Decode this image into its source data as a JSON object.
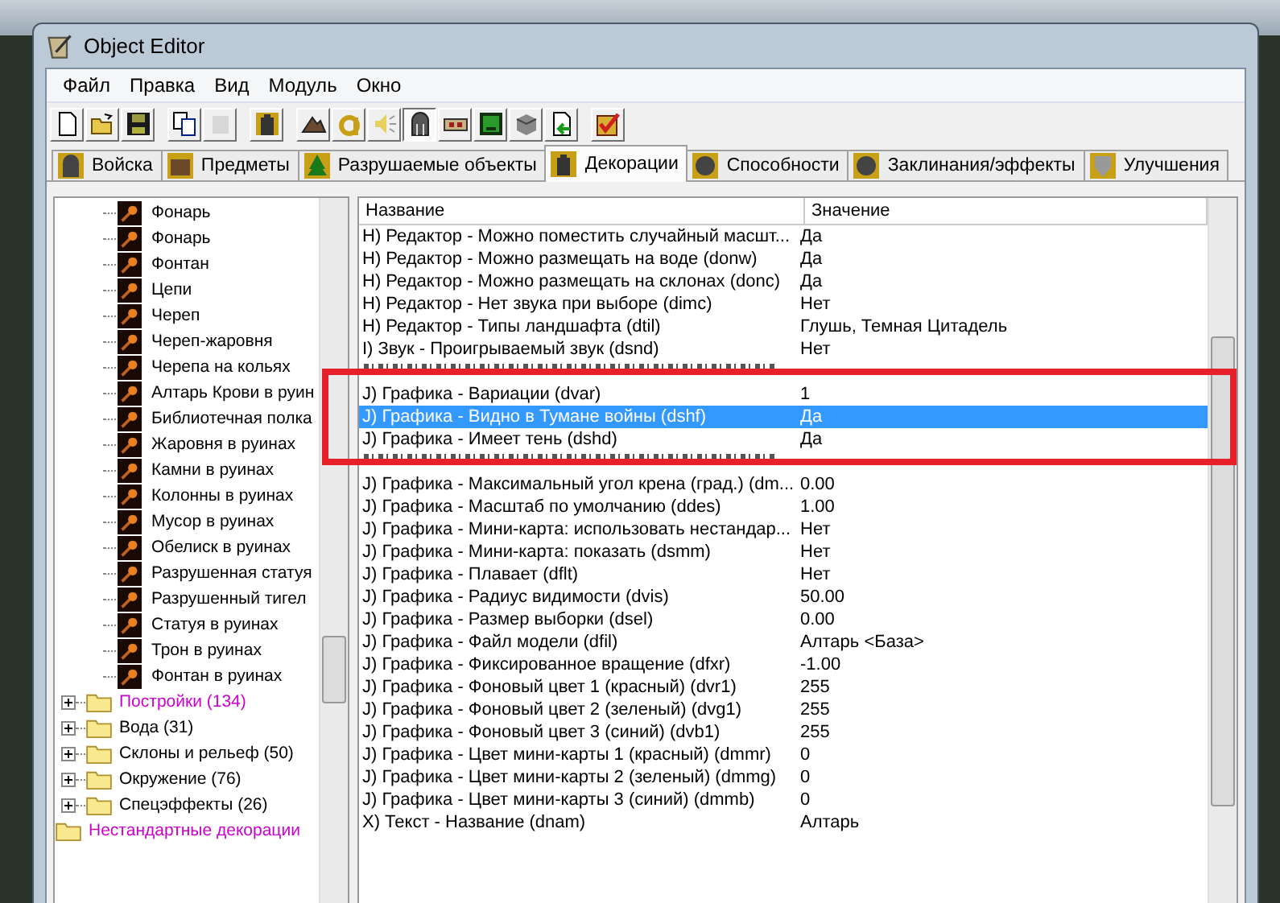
{
  "window": {
    "title": "Object Editor"
  },
  "menu": [
    "Файл",
    "Правка",
    "Вид",
    "Модуль",
    "Окно"
  ],
  "toolbar": [
    {
      "kind": "new",
      "pressed": false,
      "disabled": false
    },
    {
      "kind": "open",
      "pressed": false,
      "disabled": false
    },
    {
      "kind": "save",
      "pressed": false,
      "disabled": false
    },
    {
      "kind": "copy",
      "pressed": false,
      "disabled": false,
      "group_start": true
    },
    {
      "kind": "paste",
      "pressed": false,
      "disabled": true
    },
    {
      "kind": "tower",
      "pressed": false,
      "disabled": false,
      "group_start": true
    },
    {
      "kind": "mountain",
      "pressed": false,
      "disabled": false,
      "group_start": true
    },
    {
      "kind": "letter",
      "pressed": false,
      "disabled": false
    },
    {
      "kind": "sound",
      "pressed": false,
      "disabled": false
    },
    {
      "kind": "helmet",
      "pressed": true,
      "disabled": false
    },
    {
      "kind": "cards",
      "pressed": false,
      "disabled": false
    },
    {
      "kind": "face",
      "pressed": false,
      "disabled": false
    },
    {
      "kind": "cube",
      "pressed": false,
      "disabled": false
    },
    {
      "kind": "import",
      "pressed": false,
      "disabled": false
    },
    {
      "kind": "check",
      "pressed": false,
      "disabled": false,
      "group_start": true
    }
  ],
  "tabs": [
    {
      "label": "Войска",
      "kind": "helmet",
      "selected": false
    },
    {
      "label": "Предметы",
      "kind": "chest",
      "selected": false
    },
    {
      "label": "Разрушаемые объекты",
      "kind": "tree",
      "selected": false
    },
    {
      "label": "Декорации",
      "kind": "tower",
      "selected": true
    },
    {
      "label": "Способности",
      "kind": "fist",
      "selected": false
    },
    {
      "label": "Заклинания/эффекты",
      "kind": "fist",
      "selected": false
    },
    {
      "label": "Улучшения",
      "kind": "shield",
      "selected": false
    }
  ],
  "tree": {
    "items": [
      {
        "kind": "leaf",
        "label": "Фонарь"
      },
      {
        "kind": "leaf",
        "label": "Фонарь"
      },
      {
        "kind": "leaf",
        "label": "Фонтан"
      },
      {
        "kind": "leaf",
        "label": "Цепи"
      },
      {
        "kind": "leaf",
        "label": "Череп"
      },
      {
        "kind": "leaf",
        "label": "Череп-жаровня"
      },
      {
        "kind": "leaf",
        "label": "Черепа на кольях"
      },
      {
        "kind": "leaf",
        "label": "Алтарь Крови в руин"
      },
      {
        "kind": "leaf",
        "label": "Библиотечная полка"
      },
      {
        "kind": "leaf",
        "label": "Жаровня в руинах"
      },
      {
        "kind": "leaf",
        "label": "Камни в руинах"
      },
      {
        "kind": "leaf",
        "label": "Колонны в руинах"
      },
      {
        "kind": "leaf",
        "label": "Мусор в руинах"
      },
      {
        "kind": "leaf",
        "label": "Обелиск в руинах"
      },
      {
        "kind": "leaf",
        "label": "Разрушенная статуя"
      },
      {
        "kind": "leaf",
        "label": "Разрушенный тигел"
      },
      {
        "kind": "leaf",
        "label": "Статуя в руинах"
      },
      {
        "kind": "leaf",
        "label": "Трон в руинах"
      },
      {
        "kind": "leaf",
        "label": "Фонтан в руинах"
      },
      {
        "kind": "folder",
        "label": "Постройки (134)",
        "expanded": false,
        "modified": true
      },
      {
        "kind": "folder",
        "label": "Вода (31)",
        "expanded": false,
        "modified": false
      },
      {
        "kind": "folder",
        "label": "Склоны и рельеф (50)",
        "expanded": false,
        "modified": false
      },
      {
        "kind": "folder",
        "label": "Окружение (76)",
        "expanded": false,
        "modified": false
      },
      {
        "kind": "folder",
        "label": "Спецэффекты (26)",
        "expanded": false,
        "modified": false
      },
      {
        "kind": "root",
        "label": "Нестандартные декорации",
        "modified": true
      }
    ]
  },
  "table": {
    "columns": [
      "Название",
      "Значение"
    ],
    "rows": [
      {
        "name": "H) Редактор - Можно поместить случайный масшт...",
        "value": "Да",
        "selected": false
      },
      {
        "name": "H) Редактор - Можно размещать на воде (donw)",
        "value": "Да",
        "selected": false
      },
      {
        "name": "H) Редактор - Можно размещать на склонах (donc)",
        "value": "Да",
        "selected": false
      },
      {
        "name": "H) Редактор - Нет звука при выборе (dimc)",
        "value": "Нет",
        "selected": false
      },
      {
        "name": "H) Редактор - Типы ландшафта (dtil)",
        "value": "Глушь, Темная Цитадель",
        "selected": false
      },
      {
        "name": "I) Звук - Проигрываемый звук (dsnd)",
        "value": "Нет",
        "selected": false
      },
      {
        "kind": "covered"
      },
      {
        "name": "J) Графика - Вариации (dvar)",
        "value": "1",
        "selected": false
      },
      {
        "name": "J) Графика - Видно в Тумане войны (dshf)",
        "value": "Да",
        "selected": true
      },
      {
        "name": "J) Графика - Имеет тень (dshd)",
        "value": "Да",
        "selected": false
      },
      {
        "kind": "covered"
      },
      {
        "name": "J) Графика - Максимальный угол крена (град.) (dm...",
        "value": "0.00",
        "selected": false
      },
      {
        "name": "J) Графика - Масштаб по умолчанию (ddes)",
        "value": "1.00",
        "selected": false
      },
      {
        "name": "J) Графика - Мини-карта: использовать нестандар...",
        "value": "Нет",
        "selected": false
      },
      {
        "name": "J) Графика - Мини-карта: показать (dsmm)",
        "value": "Нет",
        "selected": false
      },
      {
        "name": "J) Графика - Плавает (dflt)",
        "value": "Нет",
        "selected": false
      },
      {
        "name": "J) Графика - Радиус видимости (dvis)",
        "value": "50.00",
        "selected": false
      },
      {
        "name": "J) Графика - Размер выборки (dsel)",
        "value": "0.00",
        "selected": false
      },
      {
        "name": "J) Графика - Файл модели (dfil)",
        "value": "Алтарь <База>",
        "selected": false
      },
      {
        "name": "J) Графика - Фиксированное вращение (dfxr)",
        "value": "-1.00",
        "selected": false
      },
      {
        "name": "J) Графика - Фоновый цвет 1 (красный) (dvr1)",
        "value": "255",
        "selected": false
      },
      {
        "name": "J) Графика - Фоновый цвет 2 (зеленый) (dvg1)",
        "value": "255",
        "selected": false
      },
      {
        "name": "J) Графика - Фоновый цвет 3 (синий) (dvb1)",
        "value": "255",
        "selected": false
      },
      {
        "name": "J) Графика - Цвет мини-карты 1 (красный) (dmmr)",
        "value": "0",
        "selected": false
      },
      {
        "name": "J) Графика - Цвет мини-карты 2 (зеленый) (dmmg)",
        "value": "0",
        "selected": false
      },
      {
        "name": "J) Графика - Цвет мини-карты 3 (синий) (dmmb)",
        "value": "0",
        "selected": false
      },
      {
        "name": "X) Текст - Название (dnam)",
        "value": "Алтарь",
        "selected": false
      }
    ]
  }
}
